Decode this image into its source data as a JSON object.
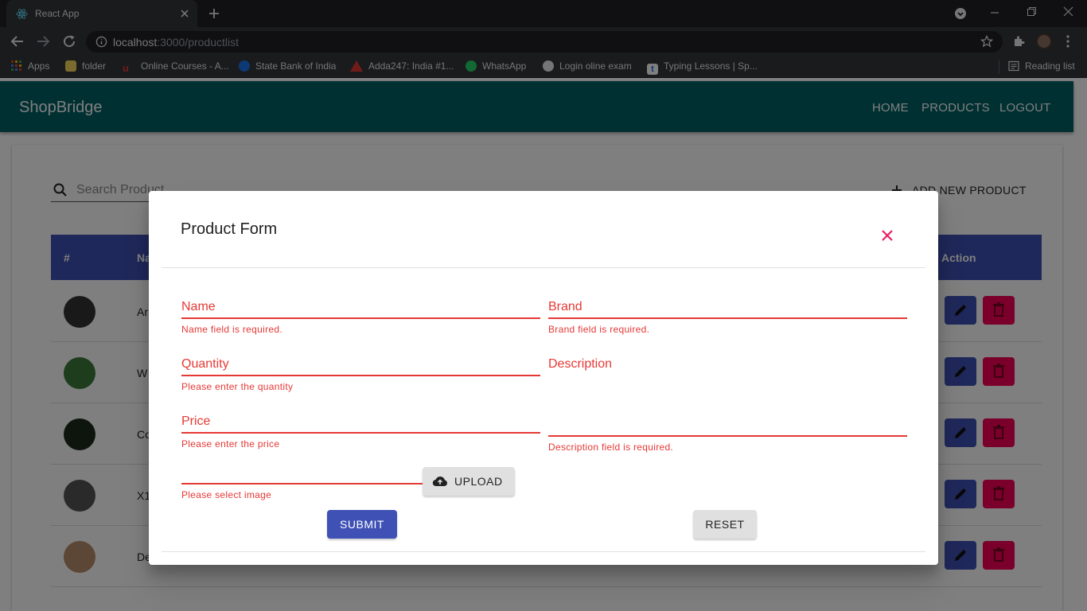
{
  "browser": {
    "tab_title": "React App",
    "url_host": "localhost",
    "url_path": ":3000/productlist",
    "bookmarks": [
      "Apps",
      "folder",
      "Online Courses - A...",
      "State Bank of India",
      "Adda247: India #1...",
      "WhatsApp",
      "Login oline exam",
      "Typing Lessons | Sp..."
    ],
    "reading_list": "Reading list"
  },
  "app": {
    "brand": "ShopBridge",
    "nav": [
      "HOME",
      "PRODUCTS",
      "LOGOUT"
    ],
    "search_placeholder": "Search Product",
    "add_new": "ADD NEW PRODUCT",
    "table": {
      "headers": [
        "#",
        "Na",
        "Action"
      ],
      "rows": [
        {
          "name": "Ar",
          "thumb_color": "#333"
        },
        {
          "name": "W",
          "thumb_color": "#3a7a3a"
        },
        {
          "name": "Co",
          "thumb_color": "#1b2b1b"
        },
        {
          "name": "X1",
          "thumb_color": "#555"
        },
        {
          "name": "De",
          "thumb_color": "#b98c6a"
        }
      ]
    }
  },
  "dialog": {
    "title": "Product Form",
    "fields": {
      "name": {
        "label": "Name",
        "error": "Name field is required."
      },
      "brand": {
        "label": "Brand",
        "error": "Brand field is required."
      },
      "quantity": {
        "label": "Quantity",
        "error": "Please enter the quantity"
      },
      "description": {
        "label": "Description",
        "error": "Description field is required."
      },
      "price": {
        "label": "Price",
        "error": "Please enter the price"
      },
      "image": {
        "error": "Please select image"
      }
    },
    "upload_label": "UPLOAD",
    "submit_label": "SUBMIT",
    "reset_label": "RESET"
  },
  "colors": {
    "appbar": "#006064",
    "primary": "#3f51b5",
    "secondary": "#f50057",
    "error": "#e53935"
  }
}
